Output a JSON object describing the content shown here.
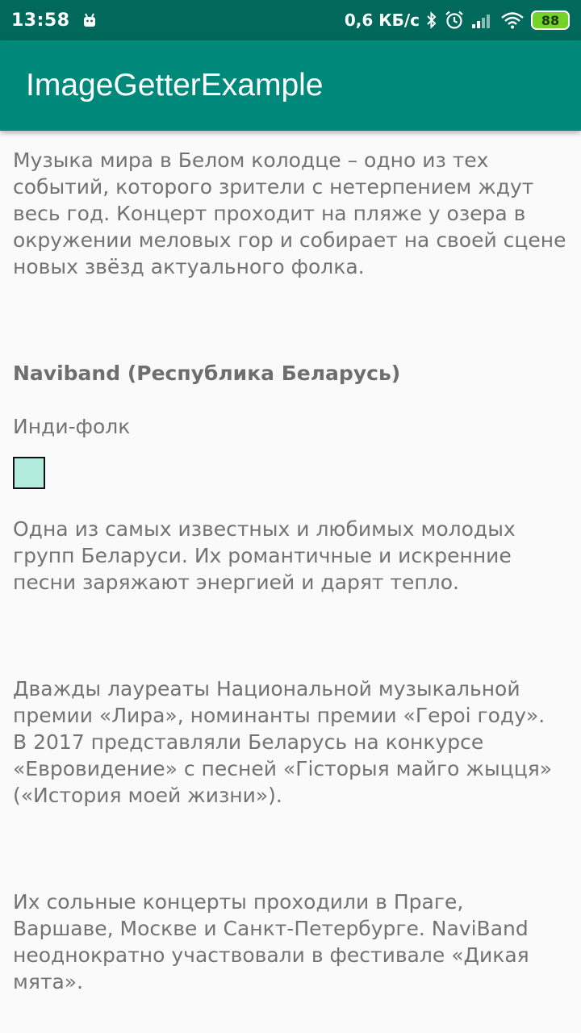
{
  "status_bar": {
    "time": "13:58",
    "speed": "0,6 КБ/с",
    "battery_level": "88",
    "icons": [
      "android-notification-icon",
      "bluetooth-icon",
      "alarm-icon",
      "signal-icon",
      "wifi-icon",
      "battery-icon"
    ]
  },
  "app_bar": {
    "title": "ImageGetterExample"
  },
  "content": {
    "intro": "Музыка мира в Белом колодце – одно из тех событий, которого зрители с нетерпением ждут весь год. Концерт проходит на пляже у озера в окружении меловых гор и собирает на своей сцене новых звёзд актуального фолка.",
    "band_name": "Naviband (Республика Беларусь)",
    "genre": "Инди-фолк",
    "image_color": "#b3ecdc",
    "para1": "Одна из самых известных и любимых молодых групп Беларуси. Их романтичные и искренние песни заряжают энергией и дарят тепло.",
    "para2_line1": "Дважды лауреаты Национальной музыкальной премии «Лира», номинанты премии «Героі году».",
    "para2_line2": "В 2017 представляли Беларусь на конкурсе «Евровидение» с песней «Гісторыя майго жыцця» («История моей жизни»).",
    "para3": "Их сольные концерты проходили в Праге, Варшаве, Москве и Санкт-Петербурге. NaviBand неоднократно участвовали в фестивале «Дикая мята»."
  },
  "colors": {
    "status_bar": "#00695c",
    "app_bar": "#00897b",
    "text": "#737373",
    "background": "#fafafa"
  }
}
